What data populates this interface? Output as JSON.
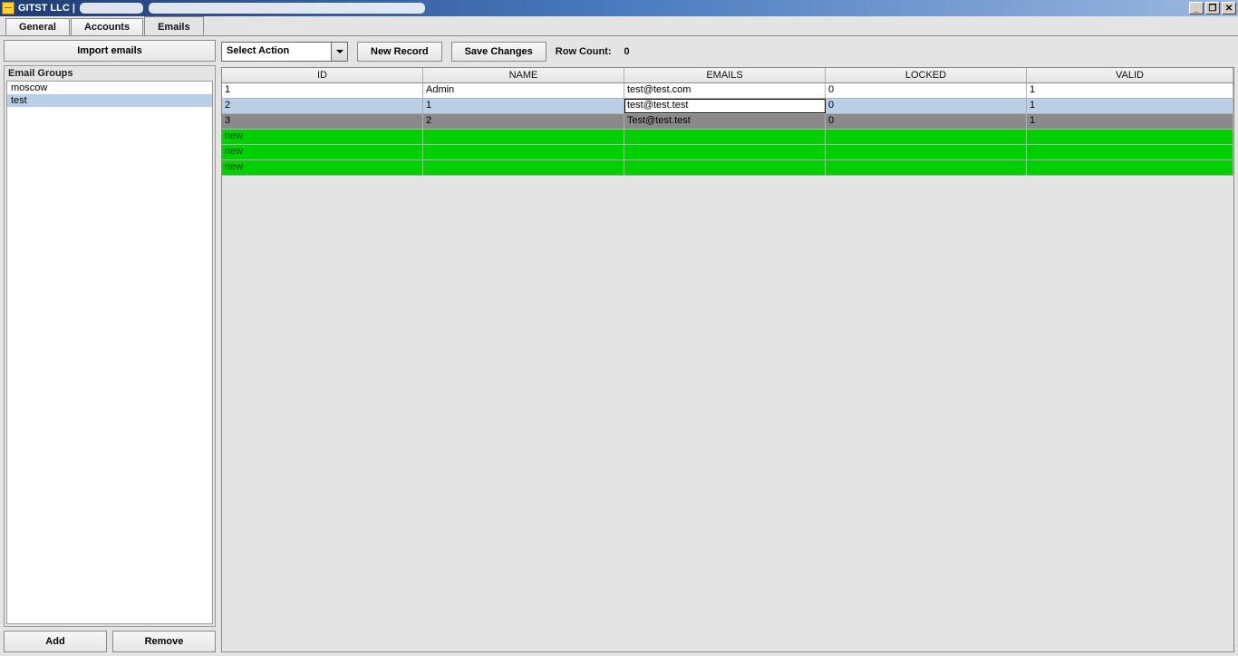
{
  "titlebar": {
    "company": "GITST LLC"
  },
  "window_buttons": {
    "min": "_",
    "restore": "❐",
    "close": "✕"
  },
  "tabs": [
    {
      "label": "General",
      "active": false
    },
    {
      "label": "Accounts",
      "active": false
    },
    {
      "label": "Emails",
      "active": true
    }
  ],
  "left": {
    "import_btn": "Import emails",
    "groups_title": "Email Groups",
    "groups": [
      {
        "name": "moscow",
        "selected": false
      },
      {
        "name": "test",
        "selected": true
      }
    ],
    "add_btn": "Add",
    "remove_btn": "Remove"
  },
  "toolbar": {
    "action_combo": "Select Action",
    "new_record": "New Record",
    "save_changes": "Save Changes",
    "row_count_label": "Row Count:",
    "row_count_value": "0"
  },
  "grid": {
    "columns": [
      "ID",
      "NAME",
      "EMAILS",
      "LOCKED",
      "VALID"
    ],
    "rows": [
      {
        "style": "r-white",
        "cells": [
          "1",
          "Admin",
          "test@test.com",
          "0",
          "1"
        ],
        "edit_col": null
      },
      {
        "style": "r-blue",
        "cells": [
          "2",
          "1",
          "test@test.test",
          "0",
          "1"
        ],
        "edit_col": 2
      },
      {
        "style": "r-grey",
        "cells": [
          "3",
          "2",
          "Test@test.test",
          "0",
          "1"
        ],
        "edit_col": null
      },
      {
        "style": "r-green",
        "cells": [
          "new",
          "",
          "",
          "",
          ""
        ],
        "edit_col": null
      },
      {
        "style": "r-green",
        "cells": [
          "new",
          "",
          "",
          "",
          ""
        ],
        "edit_col": null
      },
      {
        "style": "r-green",
        "cells": [
          "new",
          "",
          "",
          "",
          ""
        ],
        "edit_col": null
      }
    ]
  }
}
